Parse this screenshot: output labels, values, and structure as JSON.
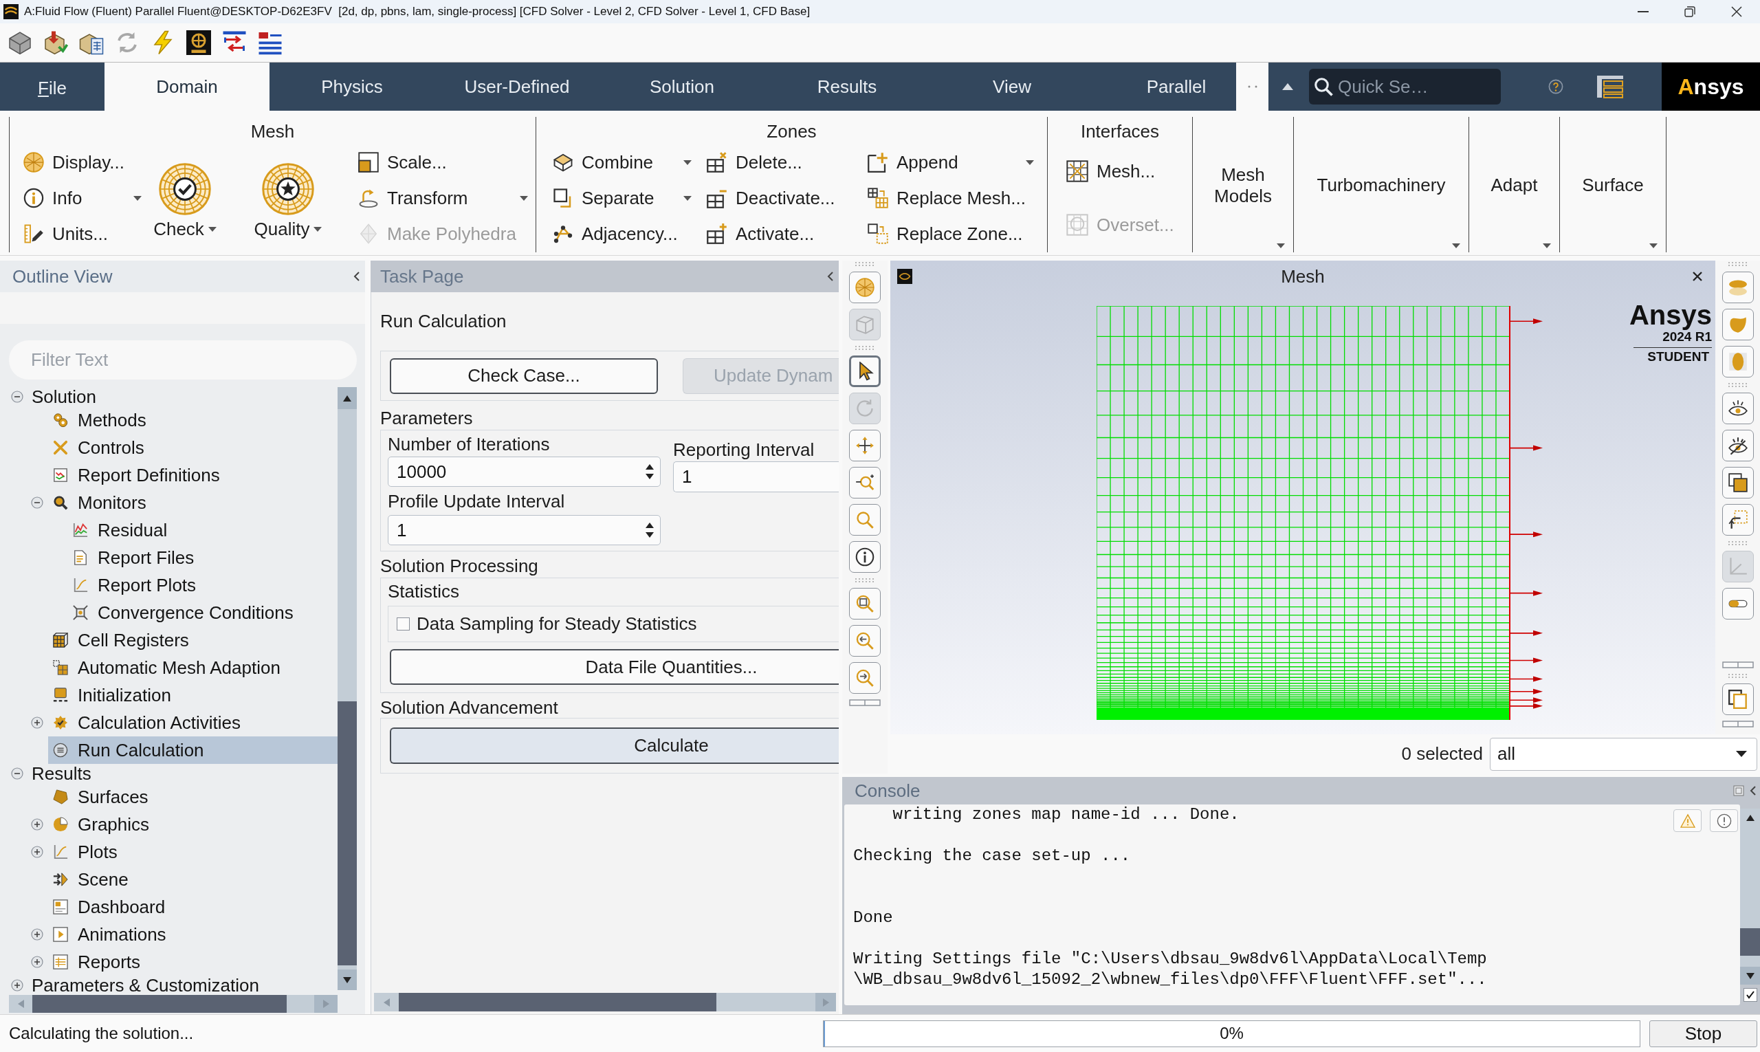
{
  "window": {
    "title": "A:Fluid Flow (Fluent) Parallel Fluent@DESKTOP-D62E3FV  [2d, dp, pbns, lam, single-process] [CFD Solver - Level 2, CFD Solver - Level 1, CFD Base]"
  },
  "tabs": [
    {
      "label": "File",
      "kind": "menu",
      "selected": false
    },
    {
      "label": "Domain",
      "kind": "tab",
      "selected": true
    },
    {
      "label": "Physics",
      "kind": "tab",
      "selected": false
    },
    {
      "label": "User-Defined",
      "kind": "tab",
      "selected": false
    },
    {
      "label": "Solution",
      "kind": "tab",
      "selected": false
    },
    {
      "label": "Results",
      "kind": "tab",
      "selected": false
    },
    {
      "label": "View",
      "kind": "tab",
      "selected": false
    },
    {
      "label": "Parallel",
      "kind": "tab",
      "selected": false
    }
  ],
  "search": {
    "placeholder": "Quick Se…"
  },
  "logo": "Ansys",
  "ribbon": {
    "groups": [
      {
        "title": "Mesh",
        "kind": "panel",
        "columns": [
          {
            "kind": "small",
            "items": [
              {
                "label": "Display...",
                "disabled": false,
                "dropdown": false
              },
              {
                "label": "Info",
                "disabled": false,
                "dropdown": true
              },
              {
                "label": "Units...",
                "disabled": false,
                "dropdown": false
              }
            ]
          },
          {
            "kind": "large",
            "items": [
              {
                "label": "Check",
                "disabled": false,
                "dropdown": true
              }
            ]
          },
          {
            "kind": "large",
            "items": [
              {
                "label": "Quality",
                "disabled": false,
                "dropdown": true
              }
            ]
          },
          {
            "kind": "small",
            "items": [
              {
                "label": "Scale...",
                "disabled": false,
                "dropdown": false
              },
              {
                "label": "Transform",
                "disabled": false,
                "dropdown": true
              },
              {
                "label": "Make Polyhedra",
                "disabled": true,
                "dropdown": false
              }
            ]
          }
        ]
      },
      {
        "title": "Zones",
        "kind": "panel",
        "columns": [
          {
            "kind": "small",
            "items": [
              {
                "label": "Combine",
                "disabled": false,
                "dropdown": true
              },
              {
                "label": "Separate",
                "disabled": false,
                "dropdown": true
              },
              {
                "label": "Adjacency...",
                "disabled": false,
                "dropdown": false
              }
            ]
          },
          {
            "kind": "small",
            "items": [
              {
                "label": "Delete...",
                "disabled": false,
                "dropdown": false
              },
              {
                "label": "Deactivate...",
                "disabled": false,
                "dropdown": false
              },
              {
                "label": "Activate...",
                "disabled": false,
                "dropdown": false
              }
            ]
          },
          {
            "kind": "small",
            "items": [
              {
                "label": "Append",
                "disabled": false,
                "dropdown": true
              },
              {
                "label": "Replace Mesh...",
                "disabled": false,
                "dropdown": false
              },
              {
                "label": "Replace Zone...",
                "disabled": false,
                "dropdown": false
              }
            ]
          }
        ]
      },
      {
        "title": "Interfaces",
        "kind": "panel",
        "columns": [
          {
            "kind": "stack",
            "items": [
              {
                "label": "Mesh...",
                "disabled": false,
                "dropdown": false
              },
              {
                "label": "Overset...",
                "disabled": true,
                "dropdown": false
              }
            ]
          }
        ]
      },
      {
        "title": "Mesh Models",
        "kind": "menu"
      },
      {
        "title": "Turbomachinery",
        "kind": "menu"
      },
      {
        "title": "Adapt",
        "kind": "menu"
      },
      {
        "title": "Surface",
        "kind": "menu"
      }
    ]
  },
  "outline": {
    "title": "Outline View",
    "filter": {
      "placeholder": "Filter Text"
    },
    "tree": [
      {
        "label": "Solution",
        "expanded": true,
        "selected": false,
        "children": [
          {
            "label": "Methods",
            "selected": false
          },
          {
            "label": "Controls",
            "selected": false
          },
          {
            "label": "Report Definitions",
            "selected": false
          },
          {
            "label": "Monitors",
            "expanded": true,
            "selected": false,
            "children": [
              {
                "label": "Residual",
                "selected": false
              },
              {
                "label": "Report Files",
                "selected": false
              },
              {
                "label": "Report Plots",
                "selected": false
              },
              {
                "label": "Convergence Conditions",
                "selected": false
              }
            ]
          },
          {
            "label": "Cell Registers",
            "selected": false
          },
          {
            "label": "Automatic Mesh Adaption",
            "selected": false
          },
          {
            "label": "Initialization",
            "selected": false
          },
          {
            "label": "Calculation Activities",
            "expanded": false,
            "selected": false
          },
          {
            "label": "Run Calculation",
            "selected": true
          }
        ]
      },
      {
        "label": "Results",
        "expanded": true,
        "selected": false,
        "children": [
          {
            "label": "Surfaces",
            "selected": false
          },
          {
            "label": "Graphics",
            "expanded": false,
            "selected": false
          },
          {
            "label": "Plots",
            "expanded": false,
            "selected": false
          },
          {
            "label": "Scene",
            "selected": false
          },
          {
            "label": "Dashboard",
            "selected": false
          },
          {
            "label": "Animations",
            "expanded": false,
            "selected": false
          },
          {
            "label": "Reports",
            "expanded": false,
            "selected": false
          }
        ]
      },
      {
        "label": "Parameters & Customization",
        "expanded": false,
        "selected": false
      }
    ]
  },
  "task_page": {
    "title": "Task Page",
    "heading": "Run Calculation",
    "top_buttons": [
      {
        "label": "Check Case...",
        "disabled": false
      },
      {
        "label": "Update Dynam",
        "disabled": true
      }
    ],
    "parameters": {
      "title": "Parameters",
      "iterations": {
        "label": "Number of Iterations",
        "value": "10000"
      },
      "profile": {
        "label": "Profile Update Interval",
        "value": "1"
      },
      "reporting": {
        "label": "Reporting Interval",
        "value": "1"
      }
    },
    "solution_processing": {
      "title": "Solution Processing",
      "statistics_title": "Statistics",
      "checkbox": {
        "label": "Data Sampling for Steady Statistics",
        "checked": false
      },
      "button": "Data File Quantities..."
    },
    "solution_advancement": {
      "title": "Solution Advancement",
      "button": "Calculate"
    }
  },
  "graphics": {
    "title": "Mesh",
    "brand": {
      "name": "Ansys",
      "version": "2024 R1",
      "edition": "STUDENT"
    },
    "selection": {
      "count": "0 selected",
      "filter": "all"
    },
    "left_tools": [
      {
        "selected": false,
        "disabled": false
      },
      {
        "selected": false,
        "disabled": true
      },
      {
        "selected": true,
        "disabled": false
      },
      {
        "selected": false,
        "disabled": true
      },
      {
        "selected": false,
        "disabled": false
      },
      {
        "selected": false,
        "disabled": false
      },
      {
        "selected": false,
        "disabled": false
      },
      {
        "selected": false,
        "disabled": false
      },
      {
        "selected": false,
        "disabled": false
      },
      {
        "selected": false,
        "disabled": false
      },
      {
        "selected": false,
        "disabled": false
      }
    ],
    "right_tools": [
      {
        "disabled": false
      },
      {
        "disabled": false
      },
      {
        "disabled": false
      },
      {
        "disabled": false
      },
      {
        "disabled": false
      },
      {
        "disabled": false
      },
      {
        "disabled": false
      },
      {
        "disabled": true
      },
      {
        "disabled": false
      },
      {
        "disabled": false
      }
    ]
  },
  "console": {
    "title": "Console",
    "output": "    writing zones map name-id ... Done.\n\nChecking the case set-up ...\n\n\nDone\n\nWriting Settings file \"C:\\Users\\dbsau_9w8dv6l\\AppData\\Local\\Temp\n\\WB_dbsau_9w8dv6l_15092_2\\wbnew_files\\dp0\\FFF\\Fluent\\FFF.set\"...",
    "checkbox": {
      "checked": true
    }
  },
  "status_bar": {
    "message": "Calculating the solution...",
    "progress": {
      "level": 0,
      "reading": "0%"
    },
    "stop": "Stop"
  }
}
